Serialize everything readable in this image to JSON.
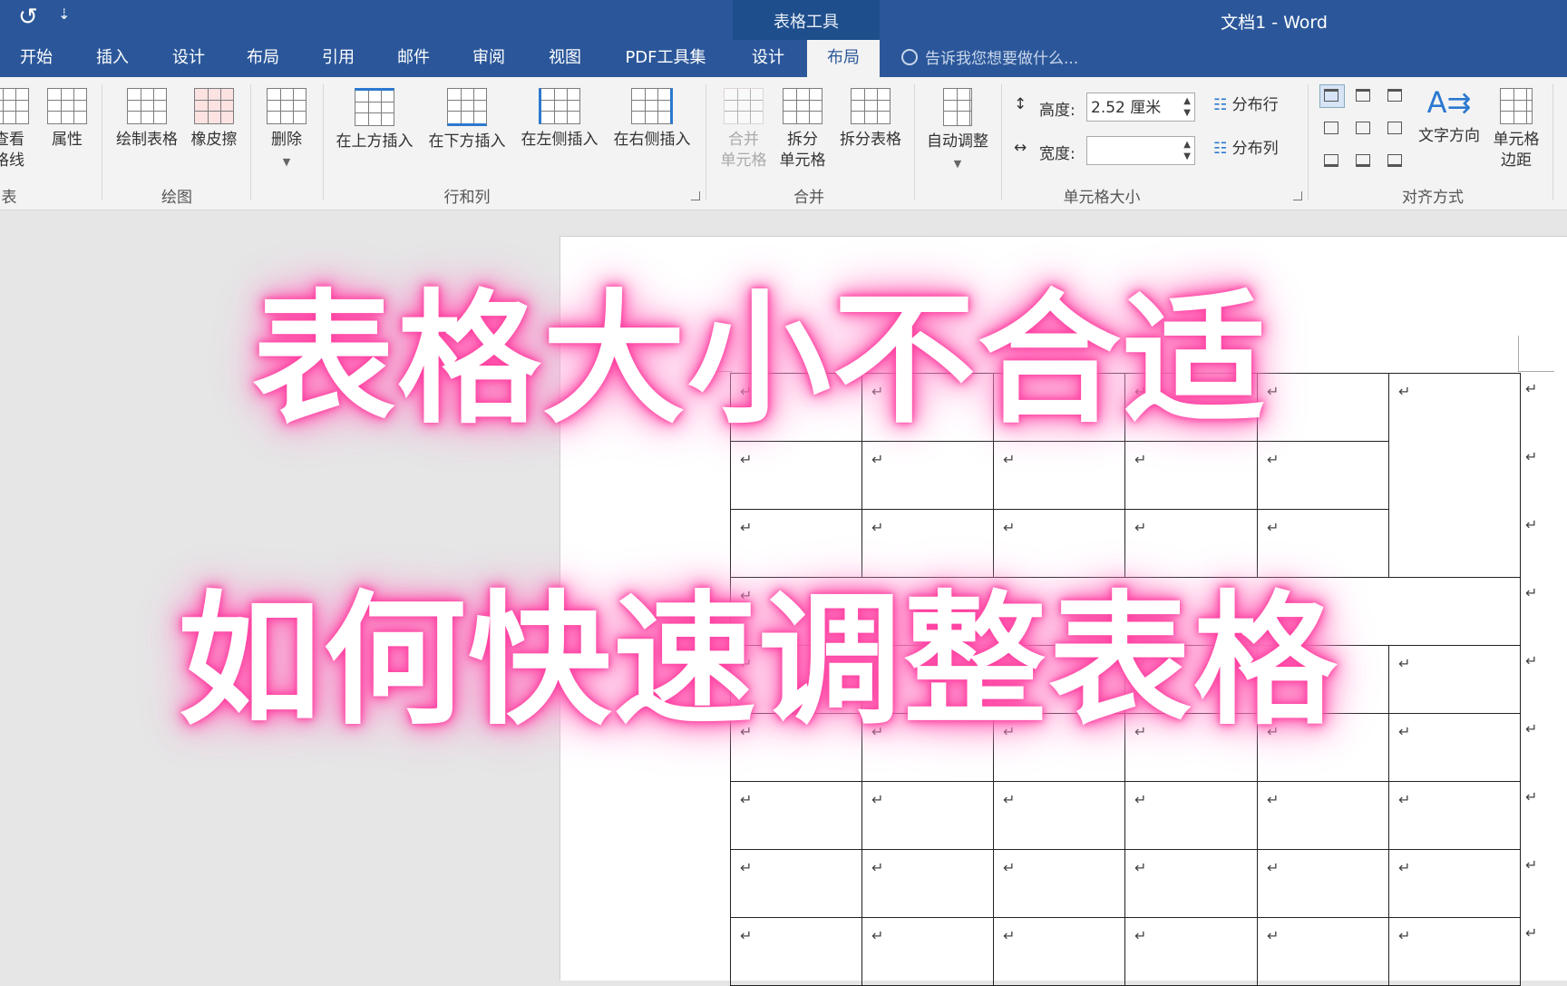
{
  "window": {
    "doc_title": "文档1 - Word",
    "context_group": "表格工具",
    "qat": {
      "redo_icon": "↺",
      "more_icon": "⇣"
    }
  },
  "tabs": [
    {
      "label": "开始",
      "active": false
    },
    {
      "label": "插入",
      "active": false
    },
    {
      "label": "设计",
      "active": false
    },
    {
      "label": "布局",
      "active": false
    },
    {
      "label": "引用",
      "active": false
    },
    {
      "label": "邮件",
      "active": false
    },
    {
      "label": "审阅",
      "active": false
    },
    {
      "label": "视图",
      "active": false
    },
    {
      "label": "PDF工具集",
      "active": false
    },
    {
      "label": "设计",
      "active": false
    },
    {
      "label": "布局",
      "active": true
    }
  ],
  "tell_me": "告诉我您想要做什么...",
  "ribbon": {
    "table_group": {
      "view_gridlines": [
        "查看",
        "格线"
      ],
      "properties": "属性",
      "label": "表"
    },
    "draw_group": {
      "draw_table": "绘制表格",
      "eraser": "橡皮擦",
      "label": "绘图"
    },
    "rows_cols_group": {
      "delete": "删除",
      "insert_above": "在上方插入",
      "insert_below": "在下方插入",
      "insert_left": "在左侧插入",
      "insert_right": "在右侧插入",
      "label": "行和列"
    },
    "merge_group": {
      "merge_cells": [
        "合并",
        "单元格"
      ],
      "split_cells": [
        "拆分",
        "单元格"
      ],
      "split_table": "拆分表格",
      "label": "合并"
    },
    "cell_size_group": {
      "autofit": "自动调整",
      "height_label": "高度:",
      "height_value": "2.52 厘米",
      "width_label": "宽度:",
      "width_value": "",
      "distribute_rows": "分布行",
      "distribute_cols": "分布列",
      "label": "单元格大小"
    },
    "alignment_group": {
      "text_direction": "文字方向",
      "cell_margins": [
        "单元格",
        "边距"
      ],
      "label": "对齐方式"
    }
  },
  "document": {
    "paragraph_mark": "↵"
  },
  "overlay": {
    "line1": "表格大小不合适",
    "line2": "如何快速调整表格"
  },
  "colors": {
    "title_bar": "#2b579a",
    "context_band": "#1e4e8c",
    "ribbon_bg": "#f3f3f3",
    "glow": "#ff3fa0"
  }
}
